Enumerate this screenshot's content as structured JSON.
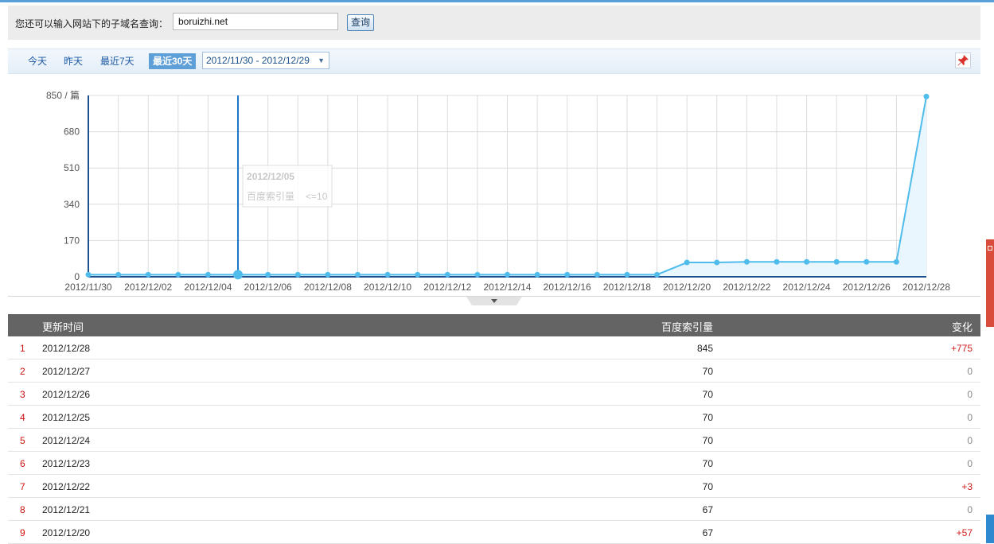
{
  "search": {
    "label": "您还可以输入网站下的子域名查询：",
    "value": "boruizhi.net",
    "button": "查询"
  },
  "date_bar": {
    "tabs": [
      {
        "label": "今天",
        "active": false
      },
      {
        "label": "昨天",
        "active": false
      },
      {
        "label": "最近7天",
        "active": false
      },
      {
        "label": "最近30天",
        "active": true
      }
    ],
    "range": "2012/11/30 - 2012/12/29",
    "pin_icon": "pin-icon"
  },
  "chart_data": {
    "type": "area",
    "x": [
      "2012/11/30",
      "2012/12/01",
      "2012/12/02",
      "2012/12/03",
      "2012/12/04",
      "2012/12/05",
      "2012/12/06",
      "2012/12/07",
      "2012/12/08",
      "2012/12/09",
      "2012/12/10",
      "2012/12/11",
      "2012/12/12",
      "2012/12/13",
      "2012/12/14",
      "2012/12/15",
      "2012/12/16",
      "2012/12/17",
      "2012/12/18",
      "2012/12/19",
      "2012/12/20",
      "2012/12/21",
      "2012/12/22",
      "2012/12/23",
      "2012/12/24",
      "2012/12/25",
      "2012/12/26",
      "2012/12/27",
      "2012/12/28"
    ],
    "x_tick_labels": [
      "2012/11/30",
      "2012/12/02",
      "2012/12/04",
      "2012/12/06",
      "2012/12/08",
      "2012/12/10",
      "2012/12/12",
      "2012/12/14",
      "2012/12/16",
      "2012/12/18",
      "2012/12/20",
      "2012/12/22",
      "2012/12/24",
      "2012/12/26",
      "2012/12/28"
    ],
    "series": [
      {
        "values": [
          10,
          10,
          10,
          10,
          10,
          10,
          10,
          10,
          10,
          10,
          10,
          10,
          10,
          10,
          10,
          10,
          10,
          10,
          10,
          10,
          67,
          67,
          70,
          70,
          70,
          70,
          70,
          70,
          845
        ]
      }
    ],
    "y_ticks": [
      "0",
      "170",
      "340",
      "510",
      "680",
      "850 / 篇"
    ],
    "ylim": [
      0,
      850
    ],
    "grid": true,
    "line_color": "#4fbcec",
    "fill_color": "#e9f6fd",
    "tooltip": {
      "index": 5,
      "date": "2012/12/05",
      "label": "百度索引量",
      "value": "<=10"
    }
  },
  "table": {
    "headers": {
      "time": "更新时间",
      "index": "百度索引量",
      "change": "变化"
    },
    "rows": [
      {
        "no": "1",
        "date": "2012/12/28",
        "value": "845",
        "change": "+775"
      },
      {
        "no": "2",
        "date": "2012/12/27",
        "value": "70",
        "change": "0"
      },
      {
        "no": "3",
        "date": "2012/12/26",
        "value": "70",
        "change": "0"
      },
      {
        "no": "4",
        "date": "2012/12/25",
        "value": "70",
        "change": "0"
      },
      {
        "no": "5",
        "date": "2012/12/24",
        "value": "70",
        "change": "0"
      },
      {
        "no": "6",
        "date": "2012/12/23",
        "value": "70",
        "change": "0"
      },
      {
        "no": "7",
        "date": "2012/12/22",
        "value": "70",
        "change": "+3"
      },
      {
        "no": "8",
        "date": "2012/12/21",
        "value": "67",
        "change": "0"
      },
      {
        "no": "9",
        "date": "2012/12/20",
        "value": "67",
        "change": "+57"
      }
    ]
  },
  "colors": {
    "accent": "#5f9fd7",
    "increase": "#d01d1d",
    "header_bg": "#646464"
  }
}
